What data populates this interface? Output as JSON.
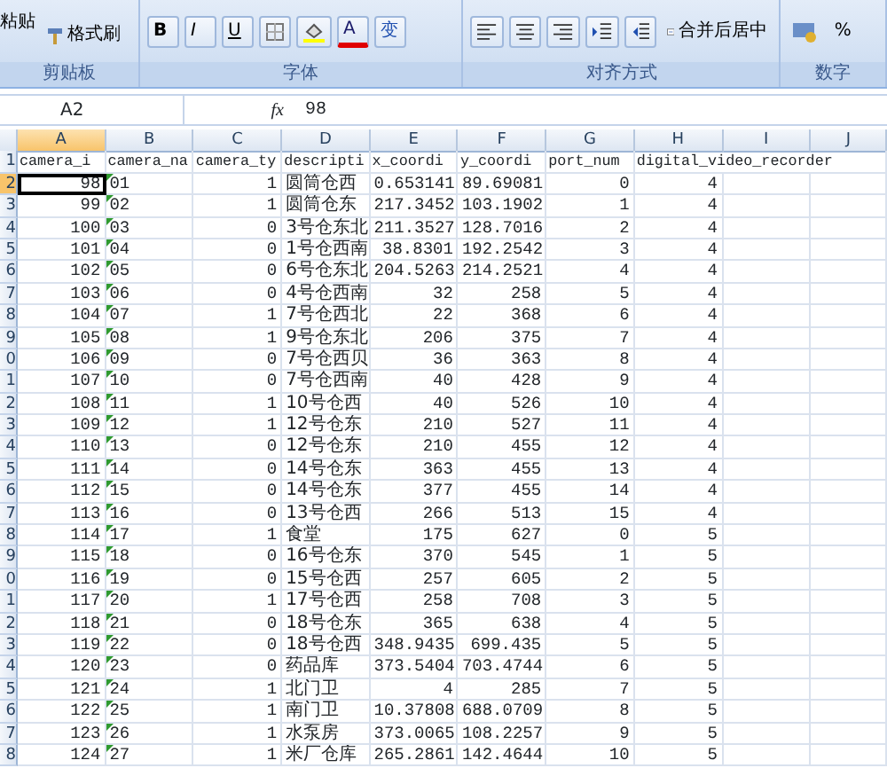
{
  "ribbon": {
    "clipboard": {
      "label": "剪贴板",
      "paste": "粘贴",
      "format_painter": "格式刷"
    },
    "font": {
      "label": "字体",
      "bold": "B",
      "italic": "I",
      "underline": "U",
      "font_color": "A",
      "phonetic": "变"
    },
    "alignment": {
      "label": "对齐方式",
      "merge": "合并后居中"
    },
    "number": {
      "label": "数字",
      "percent": "%"
    }
  },
  "formula_bar": {
    "name_box": "A2",
    "fx": "fx",
    "value": "98"
  },
  "columns": [
    {
      "label": "A",
      "selected": true
    },
    {
      "label": "B",
      "selected": false
    },
    {
      "label": "C",
      "selected": false
    },
    {
      "label": "D",
      "selected": false
    },
    {
      "label": "E",
      "selected": false
    },
    {
      "label": "F",
      "selected": false
    },
    {
      "label": "G",
      "selected": false
    },
    {
      "label": "H",
      "selected": false
    },
    {
      "label": "I",
      "selected": false
    },
    {
      "label": "J",
      "selected": false
    }
  ],
  "rows": [
    {
      "number": "1",
      "kind": "header",
      "selected": false,
      "cells": [
        "camera_i",
        "camera_na",
        "camera_ty",
        "descripti",
        "x_coordi",
        "y_coordi",
        "port_num",
        "digital_video_recorder"
      ]
    },
    {
      "number": "2",
      "kind": "data",
      "selected": true,
      "flagged": true,
      "cells": [
        "98",
        "01",
        "1",
        "圆筒仓西",
        "0.653141",
        "89.69081",
        "0",
        "4"
      ]
    },
    {
      "number": "3",
      "kind": "data",
      "selected": false,
      "flagged": true,
      "cells": [
        "99",
        "02",
        "1",
        "圆筒仓东",
        "217.3452",
        "103.1902",
        "1",
        "4"
      ]
    },
    {
      "number": "4",
      "kind": "data",
      "selected": false,
      "flagged": true,
      "cells": [
        "100",
        "03",
        "0",
        "3号仓东北",
        "211.3527",
        "128.7016",
        "2",
        "4"
      ]
    },
    {
      "number": "5",
      "kind": "data",
      "selected": false,
      "flagged": true,
      "cells": [
        "101",
        "04",
        "0",
        "1号仓西南",
        "38.8301",
        "192.2542",
        "3",
        "4"
      ]
    },
    {
      "number": "6",
      "kind": "data",
      "selected": false,
      "flagged": true,
      "cells": [
        "102",
        "05",
        "0",
        "6号仓东北",
        "204.5263",
        "214.2521",
        "4",
        "4"
      ]
    },
    {
      "number": "7",
      "kind": "data",
      "selected": false,
      "flagged": true,
      "cells": [
        "103",
        "06",
        "0",
        "4号仓西南",
        "32",
        "258",
        "5",
        "4"
      ]
    },
    {
      "number": "8",
      "kind": "data",
      "selected": false,
      "flagged": true,
      "cells": [
        "104",
        "07",
        "1",
        "7号仓西北",
        "22",
        "368",
        "6",
        "4"
      ]
    },
    {
      "number": "9",
      "kind": "data",
      "selected": false,
      "flagged": true,
      "cells": [
        "105",
        "08",
        "1",
        "9号仓东北",
        "206",
        "375",
        "7",
        "4"
      ]
    },
    {
      "number": "0",
      "kind": "data",
      "selected": false,
      "flagged": true,
      "cells": [
        "106",
        "09",
        "0",
        "7号仓西贝",
        "36",
        "363",
        "8",
        "4"
      ]
    },
    {
      "number": "1",
      "kind": "data",
      "selected": false,
      "flagged": true,
      "cells": [
        "107",
        "10",
        "0",
        "7号仓西南",
        "40",
        "428",
        "9",
        "4"
      ]
    },
    {
      "number": "2",
      "kind": "data",
      "selected": false,
      "flagged": true,
      "cells": [
        "108",
        "11",
        "1",
        "10号仓西",
        "40",
        "526",
        "10",
        "4"
      ]
    },
    {
      "number": "3",
      "kind": "data",
      "selected": false,
      "flagged": true,
      "cells": [
        "109",
        "12",
        "1",
        "12号仓东",
        "210",
        "527",
        "11",
        "4"
      ]
    },
    {
      "number": "4",
      "kind": "data",
      "selected": false,
      "flagged": true,
      "cells": [
        "110",
        "13",
        "0",
        "12号仓东",
        "210",
        "455",
        "12",
        "4"
      ]
    },
    {
      "number": "5",
      "kind": "data",
      "selected": false,
      "flagged": true,
      "cells": [
        "111",
        "14",
        "0",
        "14号仓东",
        "363",
        "455",
        "13",
        "4"
      ]
    },
    {
      "number": "6",
      "kind": "data",
      "selected": false,
      "flagged": true,
      "cells": [
        "112",
        "15",
        "0",
        "14号仓东",
        "377",
        "455",
        "14",
        "4"
      ]
    },
    {
      "number": "7",
      "kind": "data",
      "selected": false,
      "flagged": true,
      "cells": [
        "113",
        "16",
        "0",
        "13号仓西",
        "266",
        "513",
        "15",
        "4"
      ]
    },
    {
      "number": "8",
      "kind": "data",
      "selected": false,
      "flagged": true,
      "cells": [
        "114",
        "17",
        "1",
        "食堂",
        "175",
        "627",
        "0",
        "5"
      ]
    },
    {
      "number": "9",
      "kind": "data",
      "selected": false,
      "flagged": true,
      "cells": [
        "115",
        "18",
        "0",
        "16号仓东",
        "370",
        "545",
        "1",
        "5"
      ]
    },
    {
      "number": "0",
      "kind": "data",
      "selected": false,
      "flagged": true,
      "cells": [
        "116",
        "19",
        "0",
        "15号仓西",
        "257",
        "605",
        "2",
        "5"
      ]
    },
    {
      "number": "1",
      "kind": "data",
      "selected": false,
      "flagged": true,
      "cells": [
        "117",
        "20",
        "1",
        "17号仓西",
        "258",
        "708",
        "3",
        "5"
      ]
    },
    {
      "number": "2",
      "kind": "data",
      "selected": false,
      "flagged": true,
      "cells": [
        "118",
        "21",
        "0",
        "18号仓东",
        "365",
        "638",
        "4",
        "5"
      ]
    },
    {
      "number": "3",
      "kind": "data",
      "selected": false,
      "flagged": true,
      "cells": [
        "119",
        "22",
        "0",
        "18号仓西",
        "348.9435",
        "699.435",
        "5",
        "5"
      ]
    },
    {
      "number": "4",
      "kind": "data",
      "selected": false,
      "flagged": true,
      "cells": [
        "120",
        "23",
        "0",
        "药品库",
        "373.5404",
        "703.4744",
        "6",
        "5"
      ]
    },
    {
      "number": "5",
      "kind": "data",
      "selected": false,
      "flagged": true,
      "cells": [
        "121",
        "24",
        "1",
        "北门卫",
        "4",
        "285",
        "7",
        "5"
      ]
    },
    {
      "number": "6",
      "kind": "data",
      "selected": false,
      "flagged": true,
      "cells": [
        "122",
        "25",
        "1",
        "南门卫",
        "10.37808",
        "688.0709",
        "8",
        "5"
      ]
    },
    {
      "number": "7",
      "kind": "data",
      "selected": false,
      "flagged": true,
      "cells": [
        "123",
        "26",
        "1",
        "水泵房",
        "373.0065",
        "108.2257",
        "9",
        "5"
      ]
    },
    {
      "number": "8",
      "kind": "data",
      "selected": false,
      "flagged": true,
      "cells": [
        "124",
        "27",
        "1",
        "米厂仓库",
        "265.2861",
        "142.4644",
        "10",
        "5"
      ]
    }
  ]
}
